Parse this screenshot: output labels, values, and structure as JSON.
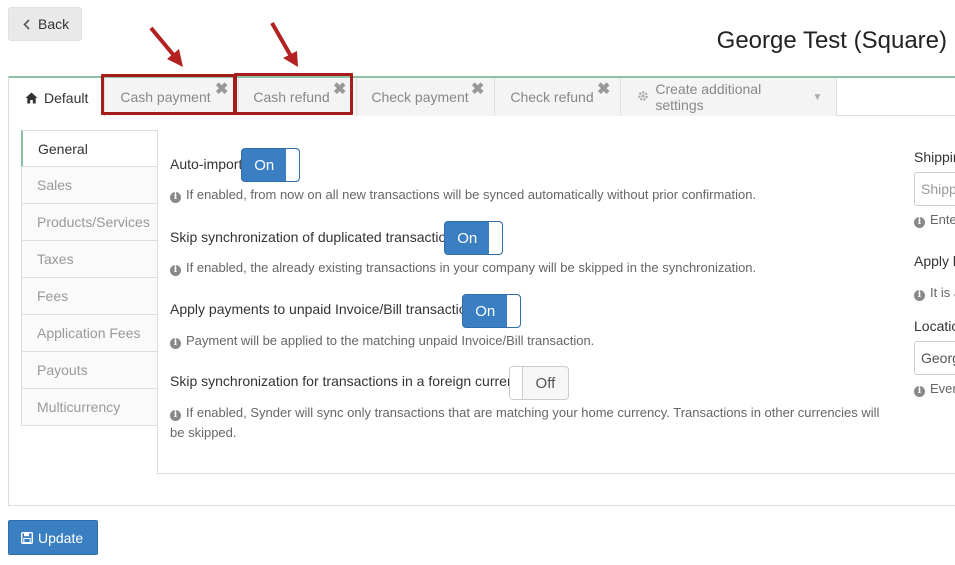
{
  "header": {
    "back_label": "Back",
    "title": "George Test (Square)"
  },
  "tabs": {
    "default": "Default",
    "cash_payment": "Cash payment",
    "cash_refund": "Cash refund",
    "check_payment": "Check payment",
    "check_refund": "Check refund",
    "create_additional": "Create additional settings",
    "close_glyph": "✖"
  },
  "sidebar": {
    "items": [
      "General",
      "Sales",
      "Products/Services",
      "Taxes",
      "Fees",
      "Application Fees",
      "Payouts",
      "Multicurrency"
    ]
  },
  "settings": {
    "auto_import": {
      "label": "Auto-import",
      "state": "On",
      "help": "If enabled, from now on all new transactions will be synced automatically without prior confirmation."
    },
    "skip_duplicates": {
      "label": "Skip synchronization of duplicated transactions",
      "state": "On",
      "help": "If enabled, the already existing transactions in your company will be skipped in the synchronization."
    },
    "apply_payments": {
      "label": "Apply payments to unpaid Invoice/Bill transactions",
      "state": "On",
      "help": "Payment will be applied to the matching unpaid Invoice/Bill transaction."
    },
    "skip_foreign": {
      "label": "Skip synchronization for transactions in a foreign currency.",
      "state": "Off",
      "help_line1": "If enabled, Synder will sync only transactions that are matching your home currency. Transactions in other currencies will",
      "help_line2": "be skipped."
    }
  },
  "right_column": {
    "shipping_label": "Shippin",
    "shipping_placeholder": "Shipp",
    "shipping_help": "Ente",
    "apply_label": "Apply l",
    "apply_help": "It is a",
    "location_label": "Locatio",
    "location_value": "Georg",
    "location_help": "Ever"
  },
  "footer": {
    "update_label": "Update"
  },
  "colors": {
    "accent_blue": "#3a7fc2",
    "highlight_red": "#a61c1c",
    "active_green": "#8cc0a7"
  }
}
